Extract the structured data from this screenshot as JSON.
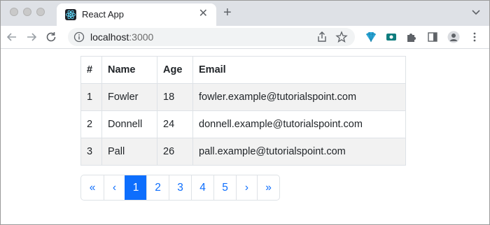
{
  "browser": {
    "tab_title": "React App",
    "url_host": "localhost",
    "url_port": ":3000"
  },
  "table": {
    "headers": [
      "#",
      "Name",
      "Age",
      "Email"
    ],
    "rows": [
      [
        "1",
        "Fowler",
        "18",
        "fowler.example@tutorialspoint.com"
      ],
      [
        "2",
        "Donnell",
        "24",
        "donnell.example@tutorialspoint.com"
      ],
      [
        "3",
        "Pall",
        "26",
        "pall.example@tutorialspoint.com"
      ]
    ]
  },
  "pagination": {
    "first": "«",
    "prev": "‹",
    "pages": [
      "1",
      "2",
      "3",
      "4",
      "5"
    ],
    "active_page": "1",
    "next": "›",
    "last": "»"
  },
  "colors": {
    "accent": "#0d6efd",
    "tabstrip": "#dee1e6",
    "striped_row": "#f2f2f2"
  },
  "icons": {
    "tab_favicon": "react-logo-icon",
    "nav": [
      "back-arrow-icon",
      "forward-arrow-icon",
      "reload-icon"
    ],
    "omnibox": [
      "info-icon",
      "share-icon",
      "star-icon"
    ],
    "extensions": [
      "extension-gem-icon",
      "extension-video-icon",
      "puzzle-icon",
      "sidebar-icon",
      "profile-icon",
      "menu-kebab-icon"
    ]
  }
}
